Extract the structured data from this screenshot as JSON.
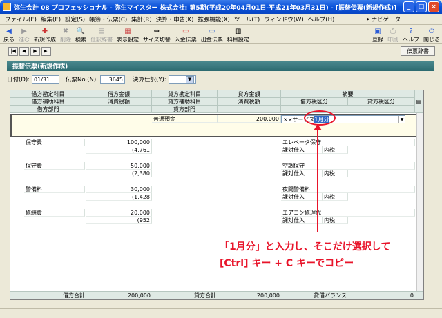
{
  "window": {
    "title": "弥生会計 08 プロフェッショナル - 弥生マイスター 株式会社: 第5期(平成20年04月01日-平成21年03月31日) - [振替伝票(新規作成)]"
  },
  "menu": {
    "items": [
      "ファイル(E)",
      "編集(E)",
      "設定(S)",
      "帳簿・伝票(C)",
      "集計(R)",
      "決算・申告(K)",
      "拡張機能(X)",
      "ツール(T)",
      "ウィンドウ(W)",
      "ヘルプ(H)"
    ],
    "navi_label": "ナビゲータ"
  },
  "toolbar": {
    "back": "戻る",
    "forward": "進む",
    "new": "新規作成",
    "delete": "削除",
    "search": "検索",
    "csv": "仕訳辞書",
    "display": "表示設定",
    "size": "サイズ切替",
    "in_slip": "入金伝票",
    "out_slip": "出金伝票",
    "account": "科目設定",
    "register": "登録",
    "print": "印刷",
    "help": "ヘルプ",
    "close": "閉じる"
  },
  "nav": {
    "dictionary_button": "伝票辞書"
  },
  "panel": {
    "title": "振替伝票(新規作成)"
  },
  "form": {
    "date_label": "日付(D):",
    "date_value": "01/31",
    "slip_no_label": "伝票No.(N):",
    "slip_no_value": "3645",
    "closing_label": "決算仕訳(Y):",
    "closing_value": ""
  },
  "headers": {
    "debit_account": "借方勘定科目",
    "debit_amount": "借方金額",
    "credit_account": "貸方勘定科目",
    "credit_amount": "貸方金額",
    "memo": "摘要",
    "debit_sub": "借方補助科目",
    "debit_tax": "消費税額",
    "credit_sub": "貸方補助科目",
    "credit_tax": "消費税額",
    "debit_tax_cat": "借方税区分",
    "credit_tax_cat": "貸方税区分",
    "debit_dept": "借方部門",
    "credit_dept": "貸方部門"
  },
  "active": {
    "credit_account": "普通預金",
    "credit_amount": "200,000",
    "memo_prefix": "××サービス",
    "memo_selected": "1月分"
  },
  "rows": [
    {
      "debit_account": "保守費",
      "debit_amount": "100,000",
      "debit_tax": "(4,761",
      "memo": "エレベータ保守",
      "tax_cat": "課対仕入",
      "tax_type": "内税"
    },
    {
      "debit_account": "保守費",
      "debit_amount": "50,000",
      "debit_tax": "(2,380",
      "memo": "空調保守",
      "tax_cat": "課対仕入",
      "tax_type": "内税"
    },
    {
      "debit_account": "警備料",
      "debit_amount": "30,000",
      "debit_tax": "(1,428",
      "memo": "夜間警備料",
      "tax_cat": "課対仕入",
      "tax_type": "内税"
    },
    {
      "debit_account": "修繕費",
      "debit_amount": "20,000",
      "debit_tax": "(952",
      "memo": "エアコン修理代",
      "tax_cat": "課対仕入",
      "tax_type": "内税"
    }
  ],
  "totals": {
    "debit_label": "借方合計",
    "debit_value": "200,000",
    "credit_label": "貸方合計",
    "credit_value": "200,000",
    "balance_label": "貸借バランス",
    "balance_value": "0"
  },
  "callout": {
    "line1": "「1月分」と入力し、そこだけ選択して",
    "line2": "[Ctrl] キー + C キーでコピー"
  },
  "colors": {
    "accent": "#e8142a",
    "panel": "#2c6a70",
    "titlebar": "#0a52d9"
  }
}
